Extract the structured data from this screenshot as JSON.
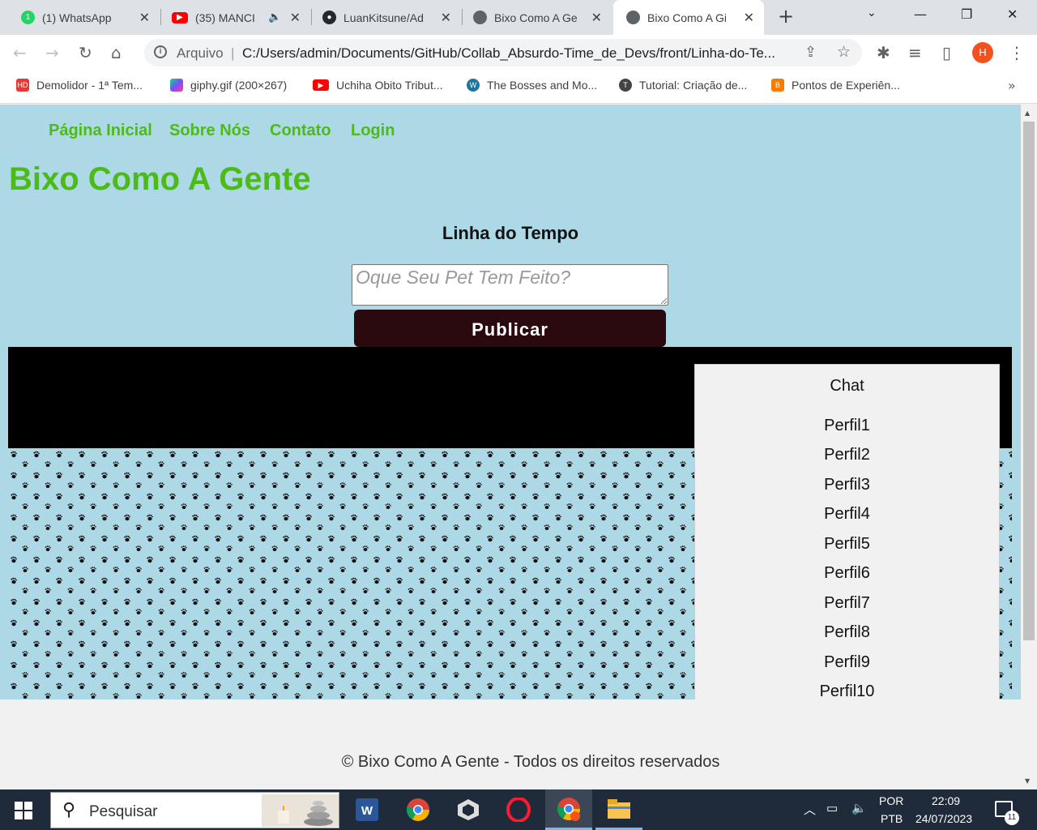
{
  "browser": {
    "tabs": [
      {
        "title": "(1) WhatsApp",
        "icon": "whatsapp-icon",
        "color": "#25d366",
        "badge": "1"
      },
      {
        "title": "(35) MANCI",
        "icon": "youtube-icon",
        "color": "#ff0000",
        "badge": ""
      },
      {
        "title": "LuanKitsune/Ad",
        "icon": "github-icon",
        "color": "#24292f",
        "badge": ""
      },
      {
        "title": "Bixo Como A Ge",
        "icon": "globe-icon",
        "color": "#5f6368",
        "badge": ""
      },
      {
        "title": "Bixo Como A Gi",
        "icon": "globe-icon",
        "color": "#5f6368",
        "badge": ""
      }
    ],
    "address": {
      "scheme": "Arquivo",
      "url": "C:/Users/admin/Documents/GitHub/Collab_Absurdo-Time_de_Devs/front/Linha-do-Te..."
    },
    "profile_initial": "H",
    "bookmarks": [
      {
        "label": "Demolidor - 1ª Tem...",
        "color": "#e53935",
        "glyph": "HD"
      },
      {
        "label": "giphy.gif (200×267)",
        "color": "#7c4dff",
        "glyph": ""
      },
      {
        "label": "Uchiha Obito Tribut...",
        "color": "#ff0000",
        "glyph": "▶"
      },
      {
        "label": "The Bosses and Mo...",
        "color": "#21759b",
        "glyph": "W"
      },
      {
        "label": "Tutorial: Criação de...",
        "color": "#444444",
        "glyph": "T"
      },
      {
        "label": "Pontos de Experiên...",
        "color": "#f57c00",
        "glyph": "B"
      }
    ]
  },
  "page": {
    "nav": [
      "Página Inicial",
      "Sobre Nós",
      "Contato",
      "Login"
    ],
    "site_title": "Bixo Como A Gente",
    "timeline_title": "Linha do Tempo",
    "post_placeholder": "Oque Seu Pet Tem Feito?",
    "publish_label": "Publicar",
    "chat": {
      "title": "Chat",
      "profiles": [
        "Perfil1",
        "Perfil2",
        "Perfil3",
        "Perfil4",
        "Perfil5",
        "Perfil6",
        "Perfil7",
        "Perfil8",
        "Perfil9",
        "Perfil10"
      ]
    },
    "footer": "© Bixo Como A Gente - Todos os direitos reservados",
    "colors": {
      "accent": "#4cbb17",
      "hero_bg": "#add8e6",
      "button_bg": "#2a0a0e"
    }
  },
  "taskbar": {
    "search_placeholder": "Pesquisar",
    "apps": [
      "word-icon",
      "chrome-icon",
      "unity-icon",
      "opera-icon",
      "chrome-profile-icon",
      "file-explorer-icon"
    ],
    "lang_top": "POR",
    "lang_bottom": "PTB",
    "time": "22:09",
    "date": "24/07/2023",
    "notifications": "11"
  }
}
